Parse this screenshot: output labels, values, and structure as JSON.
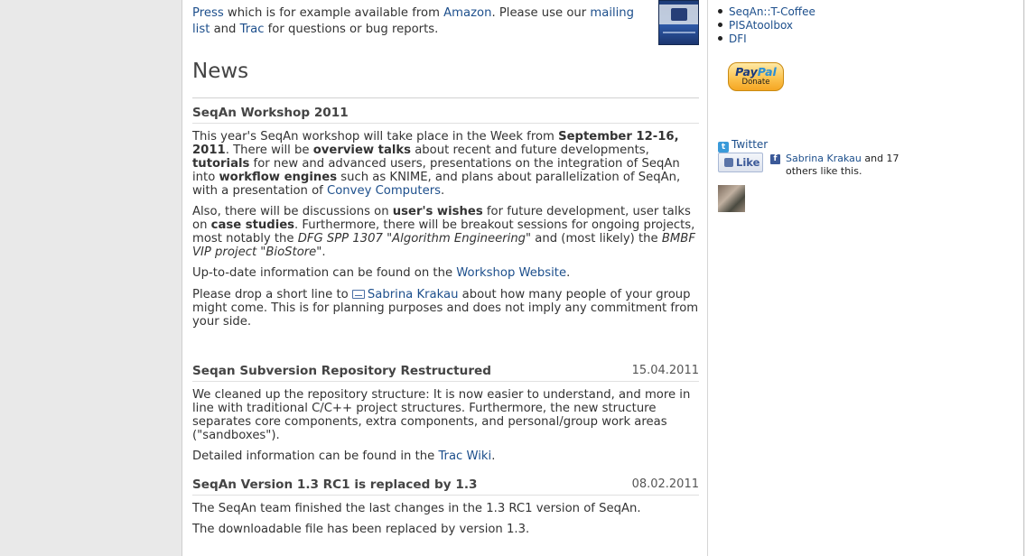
{
  "intro": {
    "press_link": "Press",
    "text1": " which is for example available from ",
    "amazon_link": "Amazon",
    "text2": ". Please use our ",
    "mailing_link": "mailing list",
    "text3": " and ",
    "trac_link": "Trac",
    "text4": " for questions or bug reports."
  },
  "news_title": "News",
  "items": [
    {
      "title": "SeqAn Workshop 2011",
      "date": "",
      "p1": {
        "a": "This year's SeqAn workshop will take place in the Week from ",
        "b": "September 12-16, 2011",
        "c": ". There will be ",
        "d": "overview talks",
        "e": " about recent and future developments, ",
        "f": "tutorials",
        "g": " for new and advanced users, presentations on the integration of SeqAn into ",
        "h": "workflow engines",
        "i": " such as KNIME, and plans about parallelization of SeqAn, with a presentation of ",
        "link": "Convey Computers",
        "j": "."
      },
      "p2": {
        "a": "Also, there will be discussions on ",
        "b": "user's wishes",
        "c": " for future development, user talks on ",
        "d": "case studies",
        "e": ". Furthermore, there will be breakout sessions for ongoing projects, most notably the ",
        "f": "DFG SPP 1307 \"Algorithm Engineering\"",
        "g": " and (most likely) the ",
        "h": "BMBF VIP project \"BioStore\"",
        "i": "."
      },
      "p3": {
        "a": "Up-to-date information can be found on the ",
        "link": "Workshop Website",
        "b": "."
      },
      "p4": {
        "a": "Please drop a short line to ",
        "link": "Sabrina Krakau",
        "b": " about how many people of your group might come. This is for planning purposes and does not imply any commitment from your side."
      }
    },
    {
      "title": "Seqan Subversion Repository Restructured",
      "date": "15.04.2011",
      "p1": "We cleaned up the repository structure: It is now easier to understand, and more in line with traditional C/C++ project structures. Furthermore, the new structure separates core components, extra components, and personal/group work areas (\"sandboxes\").",
      "p2": {
        "a": "Detailed information can be found in the ",
        "link": "Trac Wiki",
        "b": "."
      }
    },
    {
      "title": "SeqAn Version 1.3 RC1 is replaced by 1.3",
      "date": "08.02.2011",
      "p1": "The SeqAn team finished the last changes in the 1.3 RC1 version of SeqAn.",
      "p2": "The downloadable file has been replaced by version 1.3."
    }
  ],
  "sidebar": {
    "links": [
      "SeqAn::T-Coffee",
      "PISAtoolbox",
      "DFI"
    ],
    "paypal": {
      "brand_pay": "Pay",
      "brand_pal": "Pal",
      "donate": "Donate"
    },
    "twitter": "Twitter",
    "like_label": "Like",
    "fb_name": "Sabrina Krakau",
    "fb_rest": " and 17 others like this."
  },
  "colors": {
    "link": "#1d4f8c",
    "background": "#e9e9e9",
    "page": "#ffffff"
  }
}
